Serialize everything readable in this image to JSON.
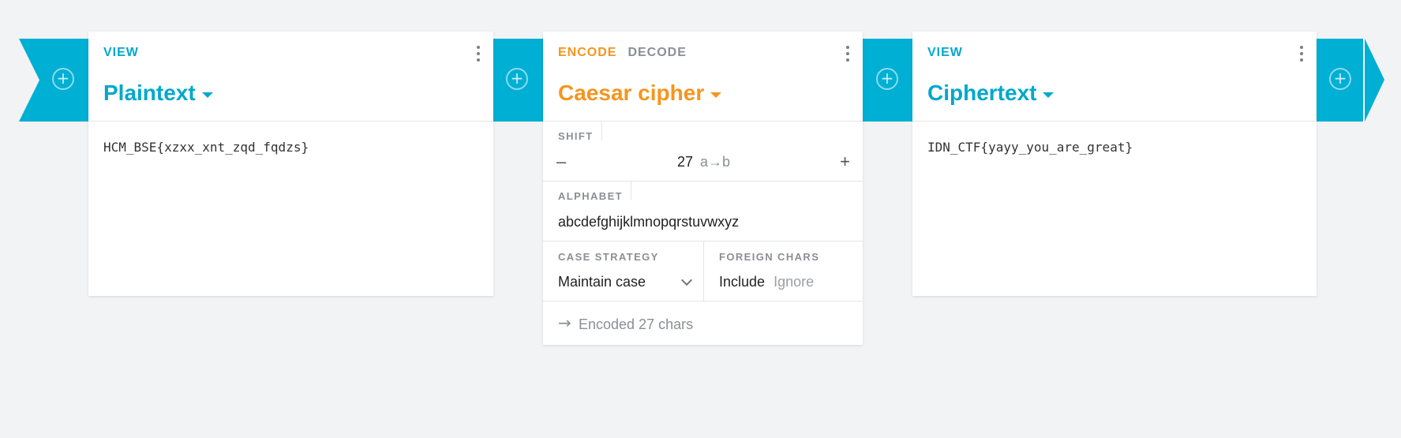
{
  "pipeline": {
    "input_card": {
      "modes": [
        "VIEW"
      ],
      "title": "Plaintext",
      "content": "HCM_BSE{xzxx_xnt_zqd_fqdzs}"
    },
    "operation_card": {
      "modes": [
        "ENCODE",
        "DECODE"
      ],
      "active_mode": "ENCODE",
      "title": "Caesar cipher",
      "shift": {
        "label": "SHIFT",
        "value": "27",
        "hint": "a→b",
        "decrement": "–",
        "increment": "+"
      },
      "alphabet": {
        "label": "ALPHABET",
        "value": "abcdefghijklmnopqrstuvwxyz"
      },
      "case_strategy": {
        "label": "CASE STRATEGY",
        "value": "Maintain case"
      },
      "foreign_chars": {
        "label": "FOREIGN CHARS",
        "options": [
          "Include",
          "Ignore"
        ],
        "selected": "Include"
      },
      "status": {
        "icon": "arrow-right-icon",
        "text": "Encoded 27 chars"
      }
    },
    "output_card": {
      "modes": [
        "VIEW"
      ],
      "title": "Ciphertext",
      "content": "IDN_CTF{yayy_you_are_great}"
    }
  },
  "colors": {
    "ribbon": "#00afd4",
    "view_accent": "#00a8cc",
    "encode_accent": "#f5951e",
    "background": "#f2f3f5"
  }
}
